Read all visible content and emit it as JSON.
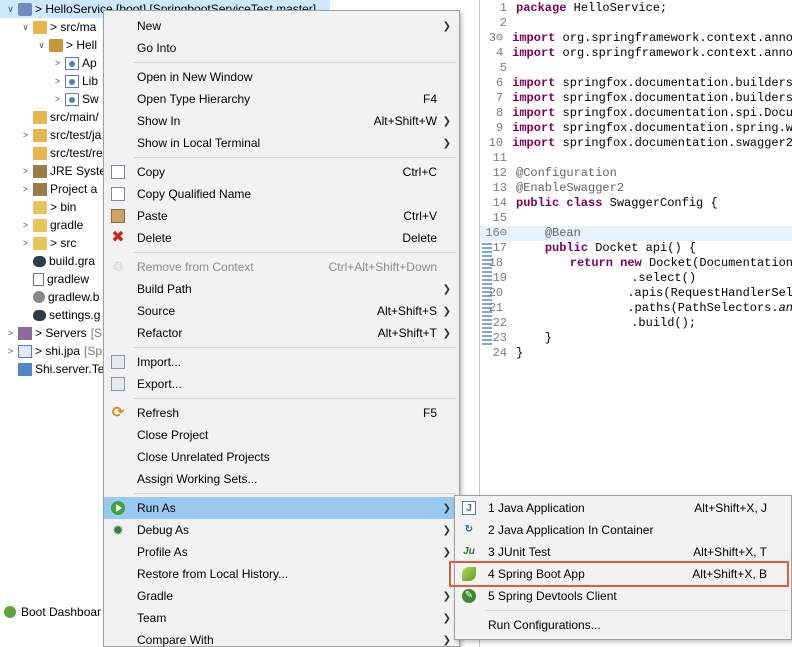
{
  "explorer": {
    "rows": [
      {
        "arrow": "∨",
        "label": "> HelloService [boot] [SpringbootServiceTest master]"
      },
      {
        "arrow": "∨",
        "label": "> src/ma"
      },
      {
        "arrow": "∨",
        "label": "> Hell"
      },
      {
        "arrow": ">",
        "label": "Ap"
      },
      {
        "arrow": ">",
        "label": "Lib"
      },
      {
        "arrow": ">",
        "label": "Sw"
      },
      {
        "arrow": "",
        "label": "src/main/"
      },
      {
        "arrow": ">",
        "label": "src/test/ja"
      },
      {
        "arrow": "",
        "label": "src/test/re"
      },
      {
        "arrow": ">",
        "label": "JRE Syste"
      },
      {
        "arrow": ">",
        "label": "Project a"
      },
      {
        "arrow": "",
        "label": "> bin"
      },
      {
        "arrow": ">",
        "label": "gradle"
      },
      {
        "arrow": ">",
        "label": "> src"
      },
      {
        "arrow": "",
        "label": "build.gra"
      },
      {
        "arrow": "",
        "label": "gradlew"
      },
      {
        "arrow": "",
        "label": "gradlew.b"
      },
      {
        "arrow": "",
        "label": "settings.g"
      },
      {
        "arrow": ">",
        "label": "> Servers",
        "tag": "[S"
      },
      {
        "arrow": ">",
        "label": "> shi.jpa",
        "tag": "[Sp"
      },
      {
        "arrow": "",
        "label": "Shi.server.Te"
      }
    ]
  },
  "boot_dashboard": {
    "label": "Boot Dashboar"
  },
  "editor": {
    "lines": [
      {
        "n": "1",
        "html_parts": [
          {
            "t": "kw",
            "v": "package"
          },
          {
            "t": "",
            "v": " HelloService;"
          }
        ]
      },
      {
        "n": "2",
        "html_parts": []
      },
      {
        "n": "3⊖",
        "html_parts": [
          {
            "t": "kw",
            "v": "import"
          },
          {
            "t": "",
            "v": " org.springframework.context.anno"
          }
        ]
      },
      {
        "n": "4",
        "html_parts": [
          {
            "t": "kw",
            "v": "import"
          },
          {
            "t": "",
            "v": " org.springframework.context.anno"
          }
        ]
      },
      {
        "n": "5",
        "html_parts": []
      },
      {
        "n": "6",
        "html_parts": [
          {
            "t": "kw",
            "v": "import"
          },
          {
            "t": "",
            "v": " springfox.documentation.builders"
          }
        ]
      },
      {
        "n": "7",
        "html_parts": [
          {
            "t": "kw",
            "v": "import"
          },
          {
            "t": "",
            "v": " springfox.documentation.builders"
          }
        ]
      },
      {
        "n": "8",
        "html_parts": [
          {
            "t": "kw",
            "v": "import"
          },
          {
            "t": "",
            "v": " springfox.documentation.spi.Docu"
          }
        ]
      },
      {
        "n": "9",
        "html_parts": [
          {
            "t": "kw",
            "v": "import"
          },
          {
            "t": "",
            "v": " springfox.documentation.spring.w"
          }
        ]
      },
      {
        "n": "10",
        "html_parts": [
          {
            "t": "kw",
            "v": "import"
          },
          {
            "t": "",
            "v": " springfox.documentation.swagger2"
          }
        ]
      },
      {
        "n": "11",
        "html_parts": []
      },
      {
        "n": "12",
        "html_parts": [
          {
            "t": "ann",
            "v": "@Configuration"
          }
        ]
      },
      {
        "n": "13",
        "html_parts": [
          {
            "t": "ann",
            "v": "@EnableSwagger2"
          }
        ]
      },
      {
        "n": "14",
        "html_parts": [
          {
            "t": "kw",
            "v": "public class"
          },
          {
            "t": "",
            "v": " SwaggerConfig {"
          }
        ]
      },
      {
        "n": "15",
        "html_parts": []
      },
      {
        "n": "16⊖",
        "hl": true,
        "html_parts": [
          {
            "t": "",
            "v": "    "
          },
          {
            "t": "ann",
            "v": "@Bean"
          }
        ]
      },
      {
        "n": "17",
        "html_parts": [
          {
            "t": "",
            "v": "    "
          },
          {
            "t": "kw",
            "v": "public"
          },
          {
            "t": "",
            "v": " Docket api() {"
          }
        ]
      },
      {
        "n": "18",
        "html_parts": [
          {
            "t": "",
            "v": "        "
          },
          {
            "t": "kw",
            "v": "return new"
          },
          {
            "t": "",
            "v": " Docket(Documentation"
          }
        ]
      },
      {
        "n": "19",
        "html_parts": [
          {
            "t": "",
            "v": "                .select()"
          }
        ]
      },
      {
        "n": "20",
        "html_parts": [
          {
            "t": "",
            "v": "                .apis(RequestHandlerSel"
          }
        ]
      },
      {
        "n": "21",
        "html_parts": [
          {
            "t": "",
            "v": "                .paths(PathSelectors."
          },
          {
            "t": "ital",
            "v": "an"
          }
        ]
      },
      {
        "n": "22",
        "html_parts": [
          {
            "t": "",
            "v": "                .build();"
          }
        ]
      },
      {
        "n": "23",
        "html_parts": [
          {
            "t": "",
            "v": "    }"
          }
        ]
      },
      {
        "n": "24",
        "html_parts": [
          {
            "t": "",
            "v": "}"
          }
        ]
      }
    ]
  },
  "context_menu": {
    "items": [
      {
        "id": "new",
        "label": "New",
        "submenu": true
      },
      {
        "id": "go-into",
        "label": "Go Into"
      },
      {
        "sep": true
      },
      {
        "id": "open-in-new-window",
        "label": "Open in New Window"
      },
      {
        "id": "open-type-hierarchy",
        "label": "Open Type Hierarchy",
        "shortcut": "F4"
      },
      {
        "id": "show-in",
        "label": "Show In",
        "shortcut": "Alt+Shift+W",
        "submenu": true
      },
      {
        "id": "show-in-local-terminal",
        "label": "Show in Local Terminal",
        "submenu": true
      },
      {
        "sep": true
      },
      {
        "id": "copy",
        "label": "Copy",
        "shortcut": "Ctrl+C",
        "icon": "copy"
      },
      {
        "id": "copy-qualified-name",
        "label": "Copy Qualified Name",
        "icon": "copy"
      },
      {
        "id": "paste",
        "label": "Paste",
        "shortcut": "Ctrl+V",
        "icon": "paste"
      },
      {
        "id": "delete",
        "label": "Delete",
        "shortcut": "Delete",
        "icon": "delete"
      },
      {
        "sep": true
      },
      {
        "id": "remove-from-context",
        "label": "Remove from Context",
        "shortcut": "Ctrl+Alt+Shift+Down",
        "icon": "remove",
        "disabled": true
      },
      {
        "id": "build-path",
        "label": "Build Path",
        "submenu": true
      },
      {
        "id": "source",
        "label": "Source",
        "shortcut": "Alt+Shift+S",
        "submenu": true
      },
      {
        "id": "refactor",
        "label": "Refactor",
        "shortcut": "Alt+Shift+T",
        "submenu": true
      },
      {
        "sep": true
      },
      {
        "id": "import",
        "label": "Import...",
        "icon": "import"
      },
      {
        "id": "export",
        "label": "Export...",
        "icon": "import"
      },
      {
        "sep": true
      },
      {
        "id": "refresh",
        "label": "Refresh",
        "shortcut": "F5",
        "icon": "refresh"
      },
      {
        "id": "close-project",
        "label": "Close Project"
      },
      {
        "id": "close-unrelated-projects",
        "label": "Close Unrelated Projects"
      },
      {
        "id": "assign-working-sets",
        "label": "Assign Working Sets..."
      },
      {
        "sep": true
      },
      {
        "id": "run-as",
        "label": "Run As",
        "submenu": true,
        "icon": "runas",
        "active": true
      },
      {
        "id": "debug-as",
        "label": "Debug As",
        "submenu": true,
        "icon": "debug"
      },
      {
        "id": "profile-as",
        "label": "Profile As",
        "submenu": true
      },
      {
        "id": "restore-from-local-history",
        "label": "Restore from Local History..."
      },
      {
        "id": "gradle",
        "label": "Gradle",
        "submenu": true
      },
      {
        "id": "team",
        "label": "Team",
        "submenu": true
      },
      {
        "id": "compare-with",
        "label": "Compare With",
        "submenu": true
      }
    ]
  },
  "run_submenu": {
    "items": [
      {
        "id": "java-application",
        "label": "1 Java Application",
        "shortcut": "Alt+Shift+X, J",
        "icon": "javaapp",
        "glyph": "J"
      },
      {
        "id": "java-application-in-container",
        "label": "2 Java Application In Container",
        "icon": "container",
        "glyph": "↻"
      },
      {
        "id": "junit-test",
        "label": "3 JUnit Test",
        "shortcut": "Alt+Shift+X, T",
        "icon": "junit",
        "glyph": "Ju"
      },
      {
        "id": "spring-boot-app",
        "label": "4 Spring Boot App",
        "shortcut": "Alt+Shift+X, B",
        "icon": "springboot",
        "glyph": ""
      },
      {
        "id": "spring-devtools-client",
        "label": "5 Spring Devtools Client",
        "icon": "devtools",
        "glyph": "✎"
      },
      {
        "sep": true
      },
      {
        "id": "run-configurations",
        "label": "Run Configurations..."
      }
    ]
  }
}
